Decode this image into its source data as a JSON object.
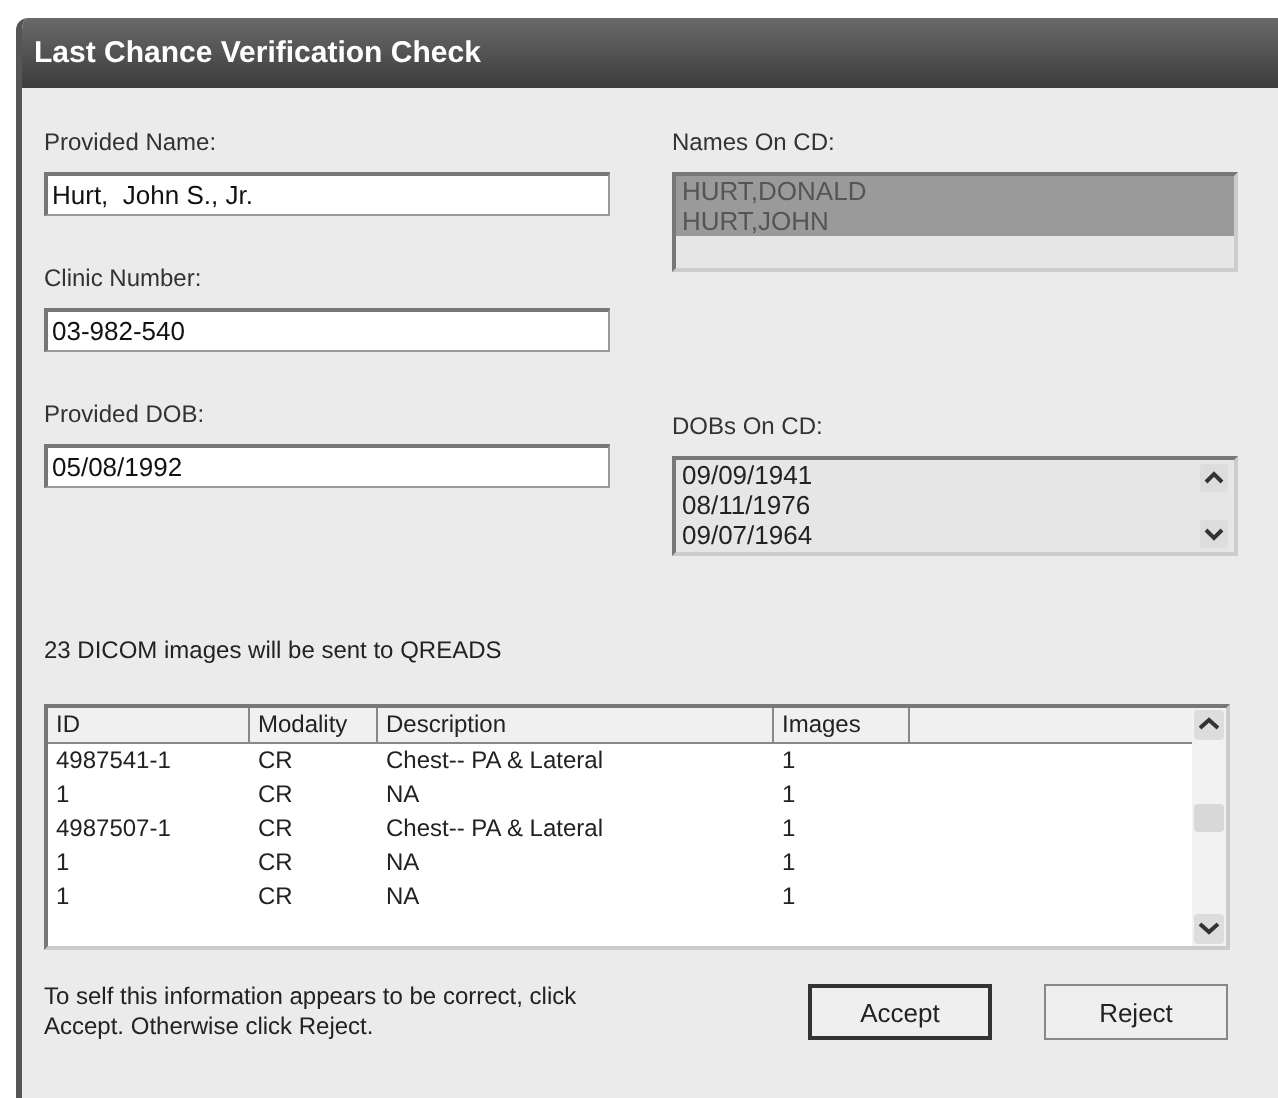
{
  "window": {
    "title": "Last Chance Verification Check"
  },
  "provided_name": {
    "label": "Provided Name:",
    "value": "Hurt,  John S., Jr."
  },
  "clinic_number": {
    "label": "Clinic Number:",
    "value": "03-982-540"
  },
  "provided_dob": {
    "label": "Provided DOB:",
    "value": "05/08/1992"
  },
  "names_on_cd": {
    "label": "Names On CD:",
    "items": [
      {
        "text": "HURT,DONALD",
        "selected": true
      },
      {
        "text": "HURT,JOHN",
        "selected": true
      }
    ]
  },
  "dobs_on_cd": {
    "label": "DOBs On CD:",
    "items": [
      {
        "text": "09/09/1941",
        "selected": false
      },
      {
        "text": "08/11/1976",
        "selected": false
      },
      {
        "text": "09/07/1964",
        "selected": false
      }
    ]
  },
  "summary": "23 DICOM  images will be sent to QREADS",
  "table": {
    "columns": [
      "ID",
      "Modality",
      "Description",
      "Images"
    ],
    "rows": [
      [
        "4987541-1",
        "CR",
        "Chest-- PA & Lateral",
        "1"
      ],
      [
        "1",
        "CR",
        "NA",
        "1"
      ],
      [
        "4987507-1",
        "CR",
        "Chest-- PA & Lateral",
        "1"
      ],
      [
        "1",
        "CR",
        "NA",
        "1"
      ],
      [
        "1",
        "CR",
        "NA",
        "1"
      ]
    ]
  },
  "instruction": "To self this information appears to be correct, click Accept.  Otherwise click Reject.",
  "buttons": [
    {
      "label": "Accept",
      "default": true
    },
    {
      "label": "Reject",
      "default": false
    }
  ]
}
